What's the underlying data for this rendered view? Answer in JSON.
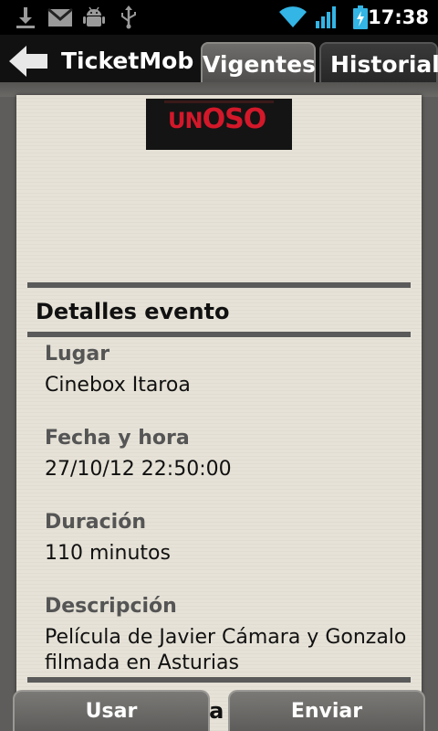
{
  "status_bar": {
    "time": "17:38",
    "icons": [
      "download-icon",
      "gmail-icon",
      "android-debug-icon",
      "usb-icon",
      "wifi-icon",
      "signal-icon",
      "battery-charging-icon"
    ]
  },
  "action_bar": {
    "back_icon": "arrow-left-icon",
    "title": "TicketMob",
    "tabs": [
      {
        "label": "Vigentes",
        "selected": true
      },
      {
        "label": "Historial",
        "selected": false
      }
    ]
  },
  "event": {
    "poster": {
      "title_small": "UN",
      "title_big": "OSO"
    },
    "section_title": "Detalles evento",
    "fields": [
      {
        "label": "Lugar",
        "value": "Cinebox Itaroa"
      },
      {
        "label": "Fecha y hora",
        "value": "27/10/12 22:50:00"
      },
      {
        "label": "Duración",
        "value": "110 minutos"
      },
      {
        "label": "Descripción",
        "value": "Película de Javier Cámara y Gonzalo filmada en Asturias"
      }
    ],
    "partially_hidden_text": "da"
  },
  "bottom_bar": {
    "use_label": "Usar",
    "send_label": "Enviar"
  },
  "colors": {
    "paper": "#e6e2d7",
    "rule": "#5a5a5a",
    "label": "#555555",
    "poster_red": "#d3182a",
    "wifi_blue": "#33b5e5"
  }
}
